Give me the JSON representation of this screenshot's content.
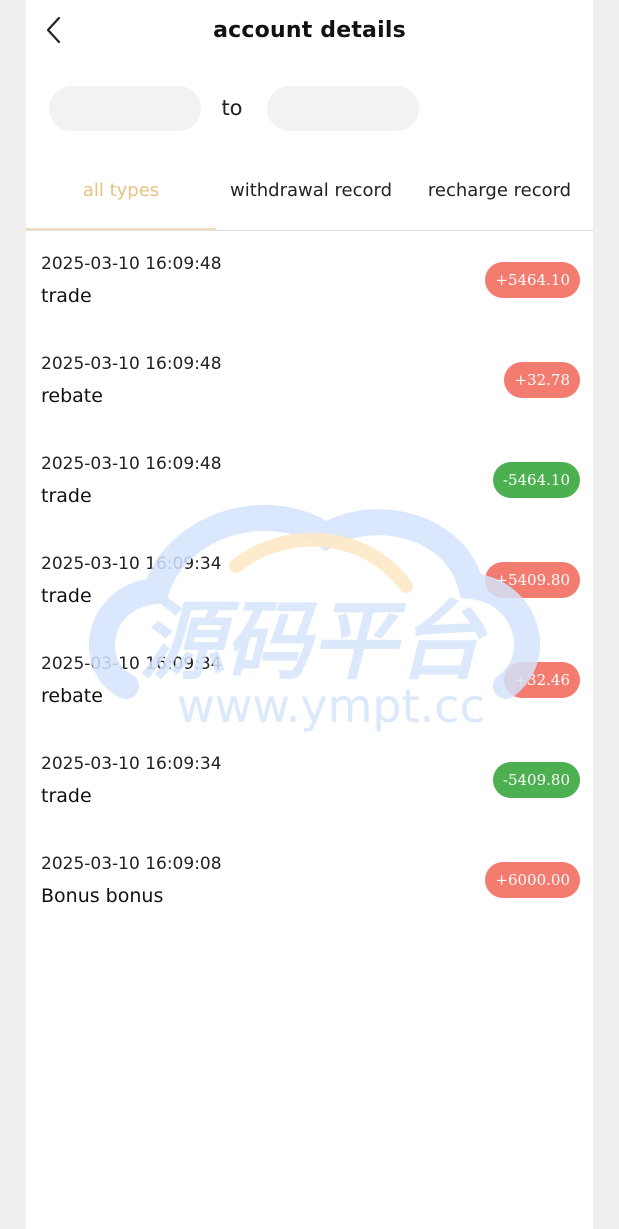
{
  "header": {
    "title": "account details",
    "back_icon": "chevron-left-icon"
  },
  "date_range": {
    "start_value": "",
    "separator": "to",
    "end_value": ""
  },
  "tabs": [
    {
      "label": "all types",
      "active": true
    },
    {
      "label": "withdrawal record",
      "active": false
    },
    {
      "label": "recharge record",
      "active": false
    }
  ],
  "colors": {
    "active_tab": "#e4c383",
    "positive_badge": "#f47b6f",
    "negative_badge": "#4caf50"
  },
  "records": [
    {
      "time": "2025-03-10 16:09:48",
      "type": "trade",
      "amount": "+5464.10",
      "direction": "positive"
    },
    {
      "time": "2025-03-10 16:09:48",
      "type": "rebate",
      "amount": "+32.78",
      "direction": "positive"
    },
    {
      "time": "2025-03-10 16:09:48",
      "type": "trade",
      "amount": "-5464.10",
      "direction": "negative"
    },
    {
      "time": "2025-03-10 16:09:34",
      "type": "trade",
      "amount": "+5409.80",
      "direction": "positive"
    },
    {
      "time": "2025-03-10 16:09:34",
      "type": "rebate",
      "amount": "+32.46",
      "direction": "positive"
    },
    {
      "time": "2025-03-10 16:09:34",
      "type": "trade",
      "amount": "-5409.80",
      "direction": "negative"
    },
    {
      "time": "2025-03-10 16:09:08",
      "type": "Bonus bonus",
      "amount": "+6000.00",
      "direction": "positive"
    }
  ],
  "watermark": {
    "text_cn": "源码平台",
    "text_url": "www.ympt.cc"
  }
}
